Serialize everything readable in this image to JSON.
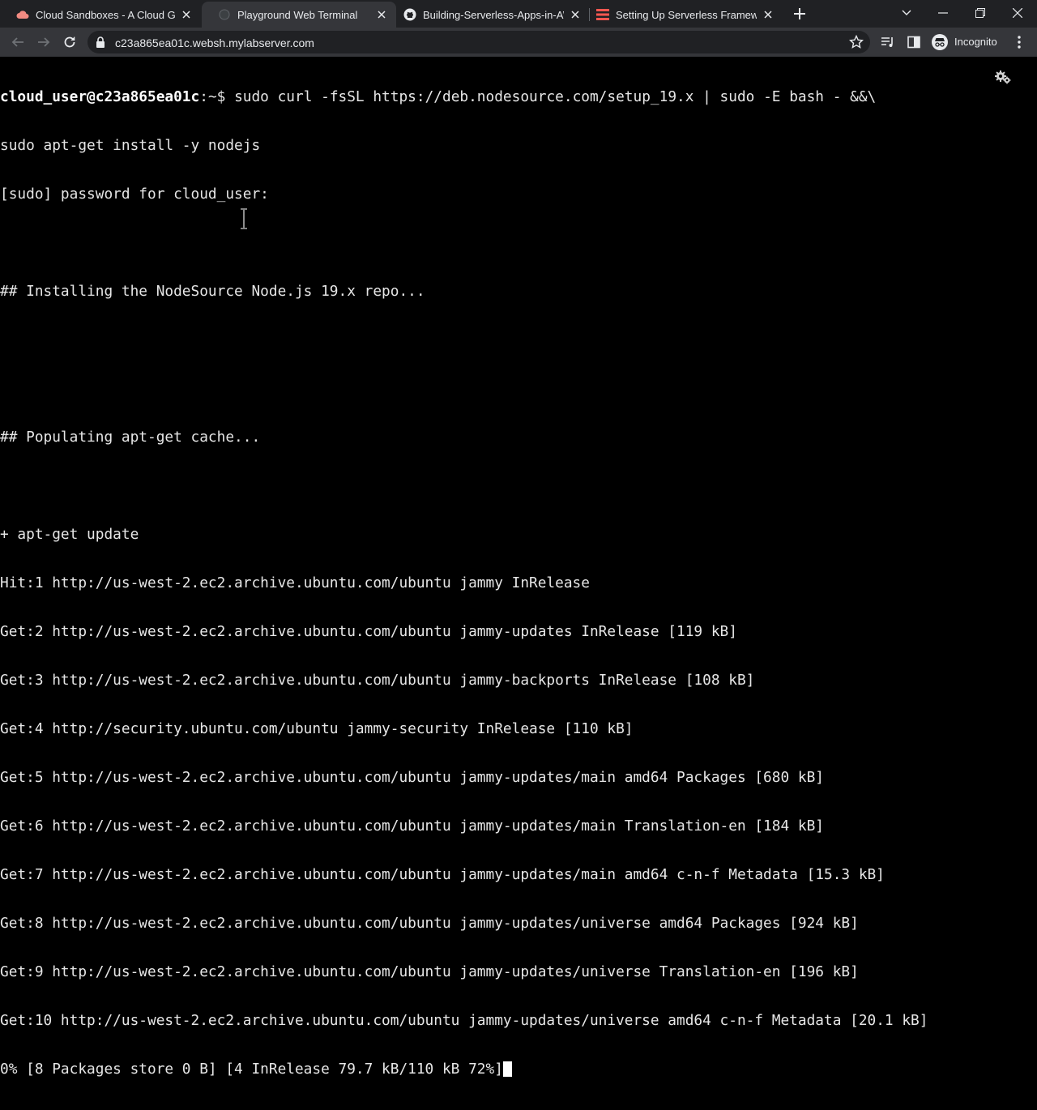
{
  "browser": {
    "tabs": [
      {
        "title": "Cloud Sandboxes - A Cloud Guru",
        "favicon": "cloud-icon",
        "active": false
      },
      {
        "title": "Playground Web Terminal",
        "favicon": "globe-icon",
        "active": true
      },
      {
        "title": "Building-Serverless-Apps-in-AWS",
        "favicon": "github-icon",
        "active": false
      },
      {
        "title": "Setting Up Serverless Framework",
        "favicon": "serverless-icon",
        "active": false
      }
    ],
    "url": "c23a865ea01c.websh.mylabserver.com",
    "incognito_label": "Incognito"
  },
  "terminal": {
    "prompt_user": "cloud_user@c23a865ea01c",
    "prompt_path": ":~$ ",
    "command_line1": "sudo curl -fsSL https://deb.nodesource.com/setup_19.x | sudo -E bash - &&\\",
    "lines": [
      "sudo apt-get install -y nodejs",
      "[sudo] password for cloud_user:",
      "",
      "## Installing the NodeSource Node.js 19.x repo...",
      "",
      "",
      "## Populating apt-get cache...",
      "",
      "+ apt-get update",
      "Hit:1 http://us-west-2.ec2.archive.ubuntu.com/ubuntu jammy InRelease",
      "Get:2 http://us-west-2.ec2.archive.ubuntu.com/ubuntu jammy-updates InRelease [119 kB]",
      "Get:3 http://us-west-2.ec2.archive.ubuntu.com/ubuntu jammy-backports InRelease [108 kB]",
      "Get:4 http://security.ubuntu.com/ubuntu jammy-security InRelease [110 kB]",
      "Get:5 http://us-west-2.ec2.archive.ubuntu.com/ubuntu jammy-updates/main amd64 Packages [680 kB]",
      "Get:6 http://us-west-2.ec2.archive.ubuntu.com/ubuntu jammy-updates/main Translation-en [184 kB]",
      "Get:7 http://us-west-2.ec2.archive.ubuntu.com/ubuntu jammy-updates/main amd64 c-n-f Metadata [15.3 kB]",
      "Get:8 http://us-west-2.ec2.archive.ubuntu.com/ubuntu jammy-updates/universe amd64 Packages [924 kB]",
      "Get:9 http://us-west-2.ec2.archive.ubuntu.com/ubuntu jammy-updates/universe Translation-en [196 kB]",
      "Get:10 http://us-west-2.ec2.archive.ubuntu.com/ubuntu jammy-updates/universe amd64 c-n-f Metadata [20.1 kB]"
    ],
    "progress_line": "0% [8 Packages store 0 B] [4 InRelease 79.7 kB/110 kB 72%]"
  },
  "colors": {
    "tab_strip": "#202124",
    "toolbar": "#35363a",
    "terminal_bg": "#000000",
    "terminal_fg": "#e6e6e6"
  }
}
